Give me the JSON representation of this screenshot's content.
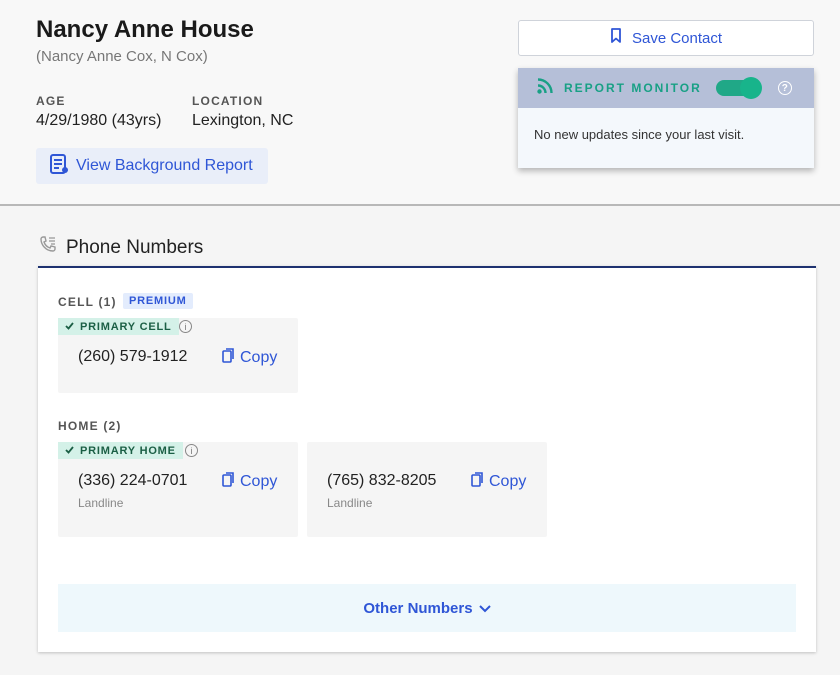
{
  "person": {
    "name": "Nancy Anne House",
    "aliases": "(Nancy Anne Cox, N Cox)",
    "age_label": "AGE",
    "age_value": "4/29/1980 (43yrs)",
    "location_label": "LOCATION",
    "location_value": "Lexington, NC",
    "report_button": "View Background Report"
  },
  "actions": {
    "save_contact": "Save Contact"
  },
  "monitor": {
    "title": "REPORT MONITOR",
    "enabled": true,
    "help_glyph": "?",
    "message": "No new updates since your last visit."
  },
  "phones": {
    "section_title": "Phone Numbers",
    "cell": {
      "label": "CELL (1)",
      "premium": "PREMIUM",
      "primary_badge": "PRIMARY CELL",
      "numbers": [
        {
          "number": "(260) 579-1912",
          "copy": "Copy"
        }
      ]
    },
    "home": {
      "label": "HOME (2)",
      "primary_badge": "PRIMARY HOME",
      "numbers": [
        {
          "number": "(336) 224-0701",
          "type": "Landline",
          "copy": "Copy"
        },
        {
          "number": "(765) 832-8205",
          "type": "Landline",
          "copy": "Copy"
        }
      ]
    },
    "other_button": "Other Numbers"
  },
  "colors": {
    "accent_blue": "#2f56d6",
    "monitor_green": "#18a085",
    "navy_border": "#1e3270"
  }
}
